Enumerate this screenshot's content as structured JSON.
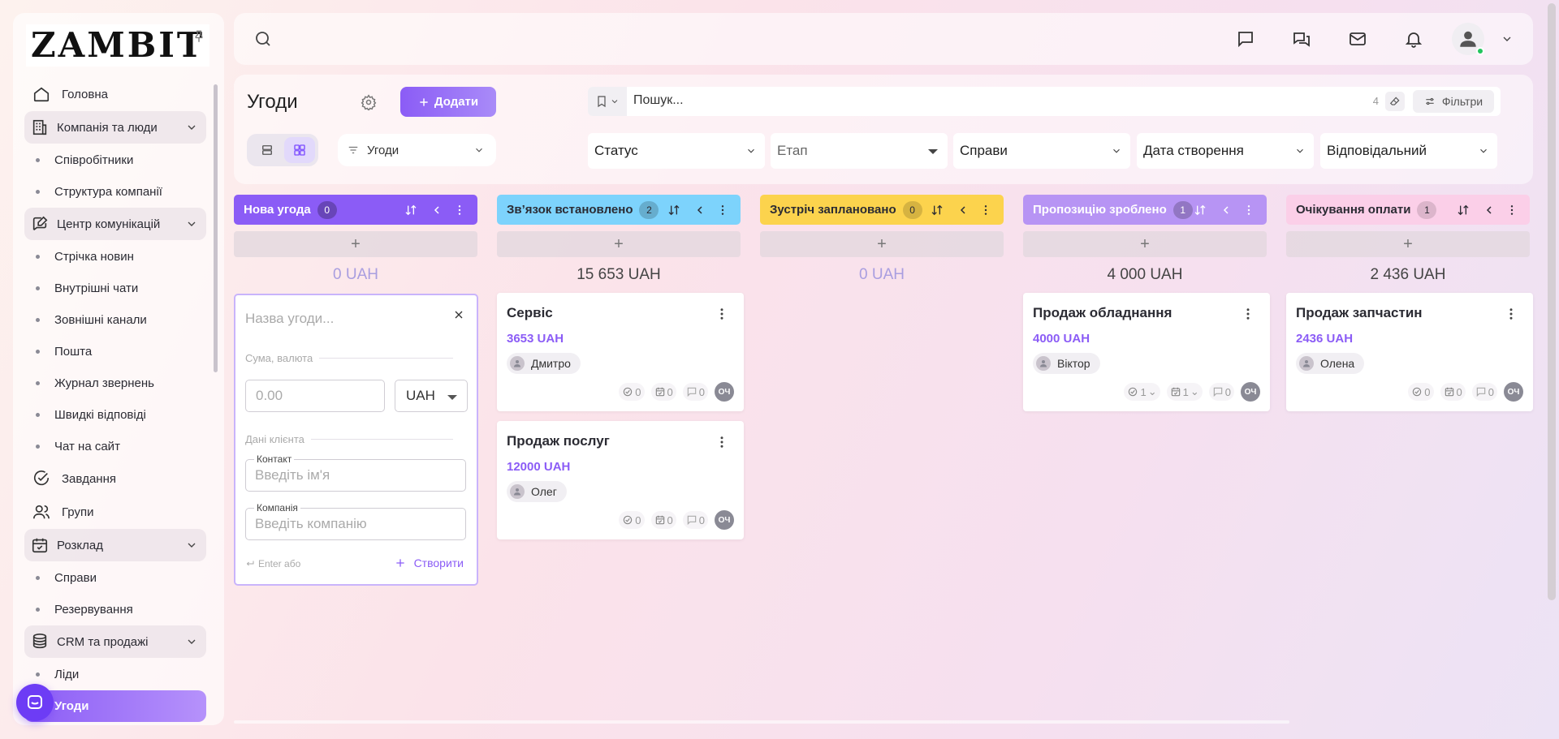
{
  "brand": {
    "logo": "ZAMBIT"
  },
  "sidebar": {
    "home": "Головна",
    "company_group": "Компанія та люди",
    "company_items": [
      "Співробітники",
      "Структура компанії"
    ],
    "comm_group": "Центр комунікацій",
    "comm_items": [
      "Стрічка новин",
      "Внутрішні чати",
      "Зовнішні канали",
      "Пошта",
      "Журнал звернень",
      "Швидкі відповіді",
      "Чат на сайт"
    ],
    "tasks": "Завдання",
    "groups": "Групи",
    "schedule_group": "Розклад",
    "schedule_items": [
      "Справи",
      "Резервування"
    ],
    "crm_group": "CRM та продажі",
    "crm_items": [
      "Ліди",
      "Угоди"
    ]
  },
  "header": {
    "title": "Угоди",
    "add_label": "Додати",
    "entity_select": "Угоди",
    "search_placeholder": "Пошук...",
    "search_count": "4",
    "filters_label": "Фільтри",
    "filters": [
      "Статус",
      "Етап",
      "Справи",
      "Дата створення",
      "Відповідальний"
    ]
  },
  "colors": {
    "accent": "#8b5cf6",
    "stage_new": "#8b5cf6",
    "stage_contact": "#7dd3fc",
    "stage_meeting": "#fcd34d",
    "stage_proposal": "#b794f4",
    "stage_payment": "#fbcfe8"
  },
  "columns": [
    {
      "name": "Нова угода",
      "count": "0",
      "sum": "0 UAH",
      "cards": []
    },
    {
      "name": "Зв’язок встановлено",
      "count": "2",
      "sum": "15 653 UAH",
      "cards": [
        {
          "title": "Сервіс",
          "amount": "3653 UAH",
          "person": "Дмитро",
          "tasks": "0",
          "events": "0",
          "comments": "0",
          "owner": "ОЧ"
        },
        {
          "title": "Продаж послуг",
          "amount": "12000 UAH",
          "person": "Олег",
          "tasks": "0",
          "events": "0",
          "comments": "0",
          "owner": "ОЧ"
        }
      ]
    },
    {
      "name": "Зустріч заплановано",
      "count": "0",
      "sum": "0 UAH",
      "cards": []
    },
    {
      "name": "Пропозицію зроблено",
      "count": "1",
      "sum": "4 000 UAH",
      "cards": [
        {
          "title": "Продаж обладнання",
          "amount": "4000 UAH",
          "person": "Віктор",
          "tasks": "1",
          "events": "1",
          "comments": "0",
          "owner": "ОЧ"
        }
      ]
    },
    {
      "name": "Очікування оплати",
      "count": "1",
      "sum": "2 436 UAH",
      "cards": [
        {
          "title": "Продаж запчастин",
          "amount": "2436 UAH",
          "person": "Олена",
          "tasks": "0",
          "events": "0",
          "comments": "0",
          "owner": "ОЧ"
        }
      ]
    }
  ],
  "new_deal_form": {
    "title_placeholder": "Назва угоди...",
    "amount_section": "Сума, валюта",
    "amount_placeholder": "0.00",
    "currency": "UAH",
    "client_section": "Дані клієнта",
    "contact_label": "Контакт",
    "contact_placeholder": "Введіть ім'я",
    "company_label": "Компанія",
    "company_placeholder": "Введіть компанію",
    "hint": "Enter або",
    "create_label": "Створити"
  }
}
